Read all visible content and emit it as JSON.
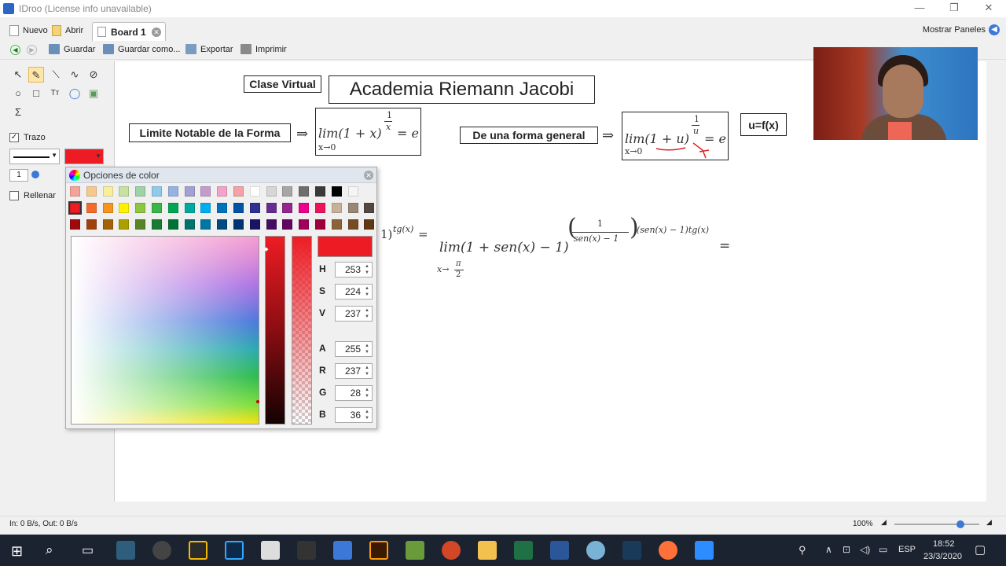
{
  "window": {
    "title": "IDroo (License info unavailable)",
    "controls": [
      "—",
      "❐",
      "✕"
    ]
  },
  "tabs_bar": {
    "nuevo": "Nuevo",
    "abrir": "Abrir",
    "tab_label": "Board 1",
    "mostrar_paneles": "Mostrar Paneles"
  },
  "toolbar": {
    "guardar": "Guardar",
    "guardar_como": "Guardar como...",
    "exportar": "Exportar",
    "imprimir": "Imprimir"
  },
  "left_panel": {
    "trazo": "Trazo",
    "rellenar": "Rellenar",
    "stroke_width": "1",
    "stroke_color": "#ed1c24"
  },
  "board": {
    "clase_virtual": "Clase Virtual",
    "academia": "Academia Riemann Jacobi",
    "limite_notable": "Limite Notable de la Forma",
    "forma_general": "De una forma general",
    "u_fx": "u=f(x)",
    "arrow": "⇒",
    "formula1": {
      "lim": "lim(1 + x)",
      "sub": "x→0",
      "exp_num": "1",
      "exp_den": "x",
      "rhs": "= e"
    },
    "formula2": {
      "lim": "lim(1 + u)",
      "sub": "x→0",
      "exp_num": "1",
      "exp_den": "u",
      "rhs": "= e"
    },
    "work": {
      "frag_left": "1)",
      "frag_left_exp": "tg(x)",
      "frag_eq": "=",
      "main": "lim(1 + sen(x) − 1)",
      "sub": "x→",
      "sub_pi": "π",
      "sub_two": "2",
      "exp_num": "1",
      "exp_den": "sen(x) − 1",
      "exp_tail": "(sen(x) − 1)tg(x)",
      "rhs": "="
    }
  },
  "color_dialog": {
    "title": "Opciones de color",
    "selected_color": "#ed1c24",
    "palette_row1": [
      "#f3a39a",
      "#f7c88e",
      "#f9ef9a",
      "#c7e1a2",
      "#9ed2a8",
      "#8fc9ec",
      "#94b3e0",
      "#a3a0d2",
      "#c49ccc",
      "#f3a3c9",
      "#f3a2a8",
      "#ffffff",
      "#d6d6d6",
      "#a6a6a6",
      "#6e6e6e",
      "#3a3a3a",
      "#000000",
      "#f5f5f5"
    ],
    "palette_row2": [
      "#ed1c24",
      "#f26b2d",
      "#f7941d",
      "#fff200",
      "#8dc63f",
      "#39b54a",
      "#00a651",
      "#00a99d",
      "#00aeef",
      "#0072bc",
      "#0054a6",
      "#2e3192",
      "#662d91",
      "#92278f",
      "#ec008c",
      "#ed145b",
      "#c7b299",
      "#998675",
      "#534741"
    ],
    "palette_row3": [
      "#9e0b0f",
      "#a0410d",
      "#a36209",
      "#aba000",
      "#598527",
      "#197b30",
      "#007236",
      "#00746b",
      "#0076a3",
      "#004a80",
      "#003471",
      "#1b1464",
      "#440e62",
      "#630460",
      "#9e005d",
      "#9e0039",
      "#8c6239",
      "#754c24",
      "#603913"
    ],
    "fields": [
      {
        "key": "H",
        "value": "253"
      },
      {
        "key": "S",
        "value": "224"
      },
      {
        "key": "V",
        "value": "237"
      },
      {
        "key": "A",
        "value": "255"
      },
      {
        "key": "R",
        "value": "237"
      },
      {
        "key": "G",
        "value": "28"
      },
      {
        "key": "B",
        "value": "36"
      }
    ]
  },
  "status": {
    "net": "In: 0 B/s, Out: 0 B/s",
    "zoom": "100%",
    "zoom_slider": 0.78
  },
  "taskbar": {
    "lang": "ESP",
    "time": "18:52",
    "date": "23/3/2020"
  }
}
